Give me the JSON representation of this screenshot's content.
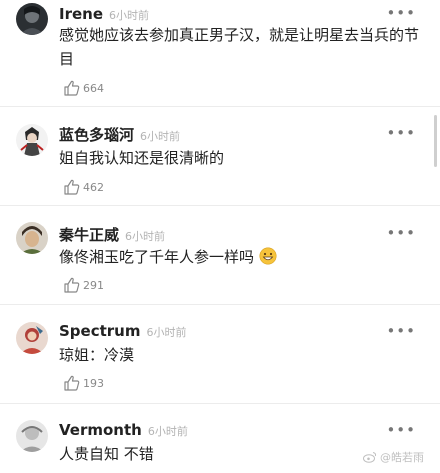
{
  "comments": [
    {
      "username": "Irene",
      "time": "6小时前",
      "text": "感觉她应该去参加真正男子汉，就是让明星去当兵的节目",
      "likes": "664",
      "avatar_icon": "avatar-dark-portrait-icon"
    },
    {
      "username": "蓝色多瑙河",
      "time": "6小时前",
      "text": "姐自我认知还是很清晰的",
      "likes": "462",
      "avatar_icon": "avatar-anime-figure-icon"
    },
    {
      "username": "秦牛正威",
      "time": "6小时前",
      "text": "像佟湘玉吃了千年人参一样吗",
      "likes": "291",
      "avatar_icon": "avatar-portrait-icon"
    },
    {
      "username": "Spectrum",
      "time": "6小时前",
      "text": "琼姐：冷漠",
      "likes": "193",
      "avatar_icon": "avatar-colorful-icon"
    },
    {
      "username": "Vermonth",
      "time": "6小时前",
      "text": "人贵自知 不错",
      "likes": "",
      "avatar_icon": "avatar-sketch-icon"
    }
  ],
  "more_label": "•••",
  "watermark": "@皓若雨",
  "colors": {
    "text": "#222222",
    "meta": "#b3b3b3",
    "divider": "#ececec"
  }
}
